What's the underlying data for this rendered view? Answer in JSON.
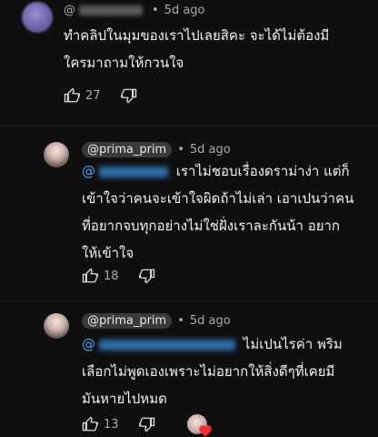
{
  "comments": [
    {
      "author_prefix": "@",
      "time": "5d ago",
      "lines": [
        "ทำคลิปในมุมของเราไปเลยสิคะ จะได้ไม่ต้องมี",
        "ใครมาถามให้กวนใจ"
      ],
      "likes": "27"
    },
    {
      "author": "@prima_prim",
      "time": "5d ago",
      "mention_prefix": "@",
      "lines": [
        "เราไม่ชอบเรื่องดราม่าง่า แต่ก็",
        "เข้าใจว่าคนจะเข้าใจผิดถ้าไม่เล่า เอาเปนว่าคน",
        "ที่อยากจบทุกอย่างไม่ใช่ฝั่งเราละกันน้า อยาก",
        "ให้เข้าใจ"
      ],
      "likes": "18"
    },
    {
      "author": "@prima_prim",
      "time": "5d ago",
      "mention_prefix": "@",
      "lines": [
        "ไม่เปนไรค่า พริม",
        "เลือกไม่พูดเองเพราะไม่อยากให้สิ่งดีๆที่เคยมี",
        "มันหายไปหมด"
      ],
      "likes": "13"
    }
  ],
  "icons": {
    "like": "thumbs-up-icon",
    "dislike": "thumbs-down-icon"
  }
}
